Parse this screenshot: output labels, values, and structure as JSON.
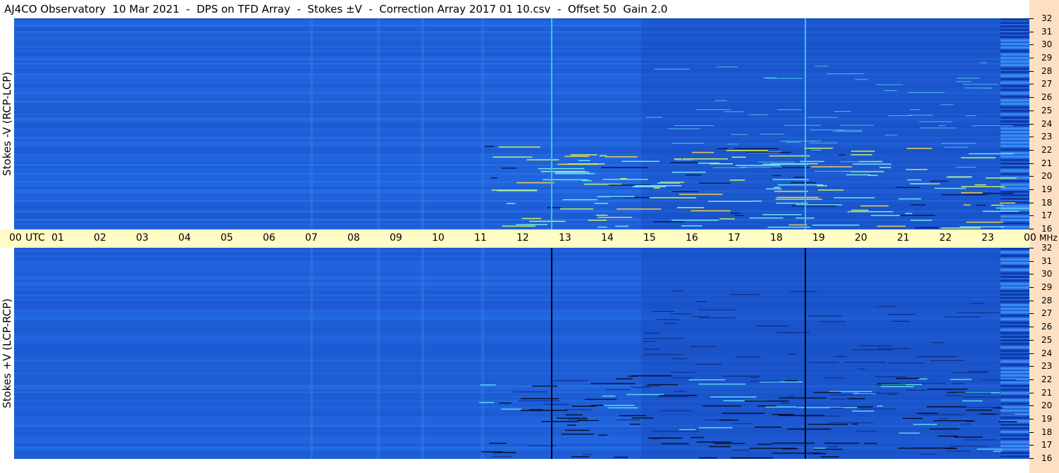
{
  "title": "AJ4CO Observatory  10 Mar 2021  -  DPS on TFD Array  -  Stokes ±V  -  Correction Array 2017 01 10.csv  -  Offset 50  Gain 2.0",
  "panels": {
    "top_label": "Stokes -V (RCP-LCP)",
    "bottom_label": "Stokes +V (LCP-RCP)"
  },
  "time_axis": {
    "labels": [
      "00",
      "UTC",
      "01",
      "02",
      "03",
      "04",
      "05",
      "06",
      "07",
      "08",
      "09",
      "10",
      "11",
      "12",
      "13",
      "14",
      "15",
      "16",
      "17",
      "18",
      "19",
      "20",
      "21",
      "22",
      "23",
      "00"
    ],
    "unit_label": "MHz"
  },
  "freq_axis": {
    "labels": [
      "32",
      "31",
      "30",
      "29",
      "28",
      "27",
      "26",
      "25",
      "24",
      "23",
      "22",
      "21",
      "20",
      "19",
      "18",
      "17",
      "16"
    ]
  },
  "colors": {
    "background": "#ffffff",
    "spectrogram_base": "#1e5fd8",
    "time_band": "#fffcc4",
    "freq_band": "#fde0c4",
    "marker_top": "#33c7e8",
    "marker_bottom": "#000000"
  },
  "markers_utc": [
    12.7,
    18.7
  ]
}
